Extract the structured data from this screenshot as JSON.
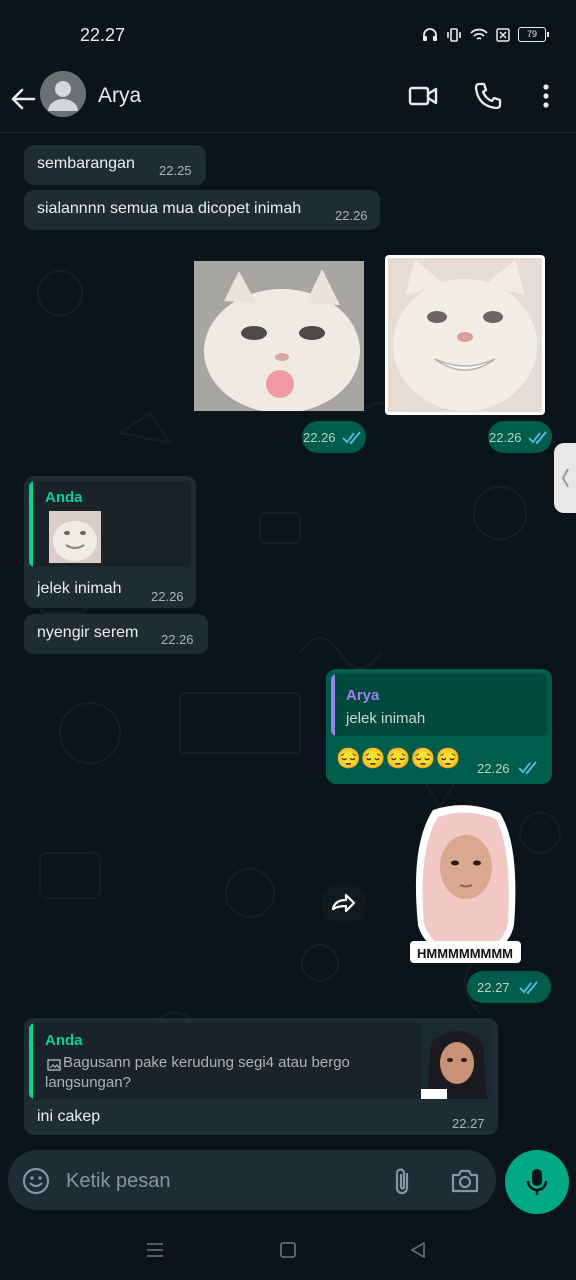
{
  "status": {
    "time": "22.27",
    "battery": "79"
  },
  "header": {
    "contact_name": "Arya"
  },
  "messages": {
    "m1": {
      "text": "sembarangan",
      "time": "22.25"
    },
    "m2": {
      "text": "sialannnn semua mua dicopet inimah",
      "time": "22.26"
    },
    "sticker1": {
      "time": "22.26"
    },
    "sticker2": {
      "time": "22.26"
    },
    "m3": {
      "quote_name": "Anda",
      "text": "jelek inimah",
      "time": "22.26"
    },
    "m4": {
      "text": "nyengir serem",
      "time": "22.26"
    },
    "m5": {
      "quote_name": "Arya",
      "quote_text": "jelek inimah",
      "text": "😔😔😔😔😔",
      "time": "22.26"
    },
    "sticker3": {
      "caption": "HMMMMMMMM",
      "time": "22.27"
    },
    "m6": {
      "quote_name": "Anda",
      "quote_text": "Bagusann pake kerudung segi4 atau bergo langsungan?",
      "text": "ini cakep",
      "time": "22.27"
    }
  },
  "input": {
    "placeholder": "Ketik pesan"
  },
  "colors": {
    "accent": "#00a884",
    "outgoing": "#005c4b",
    "incoming": "#202c33",
    "tick": "#53bdeb"
  }
}
